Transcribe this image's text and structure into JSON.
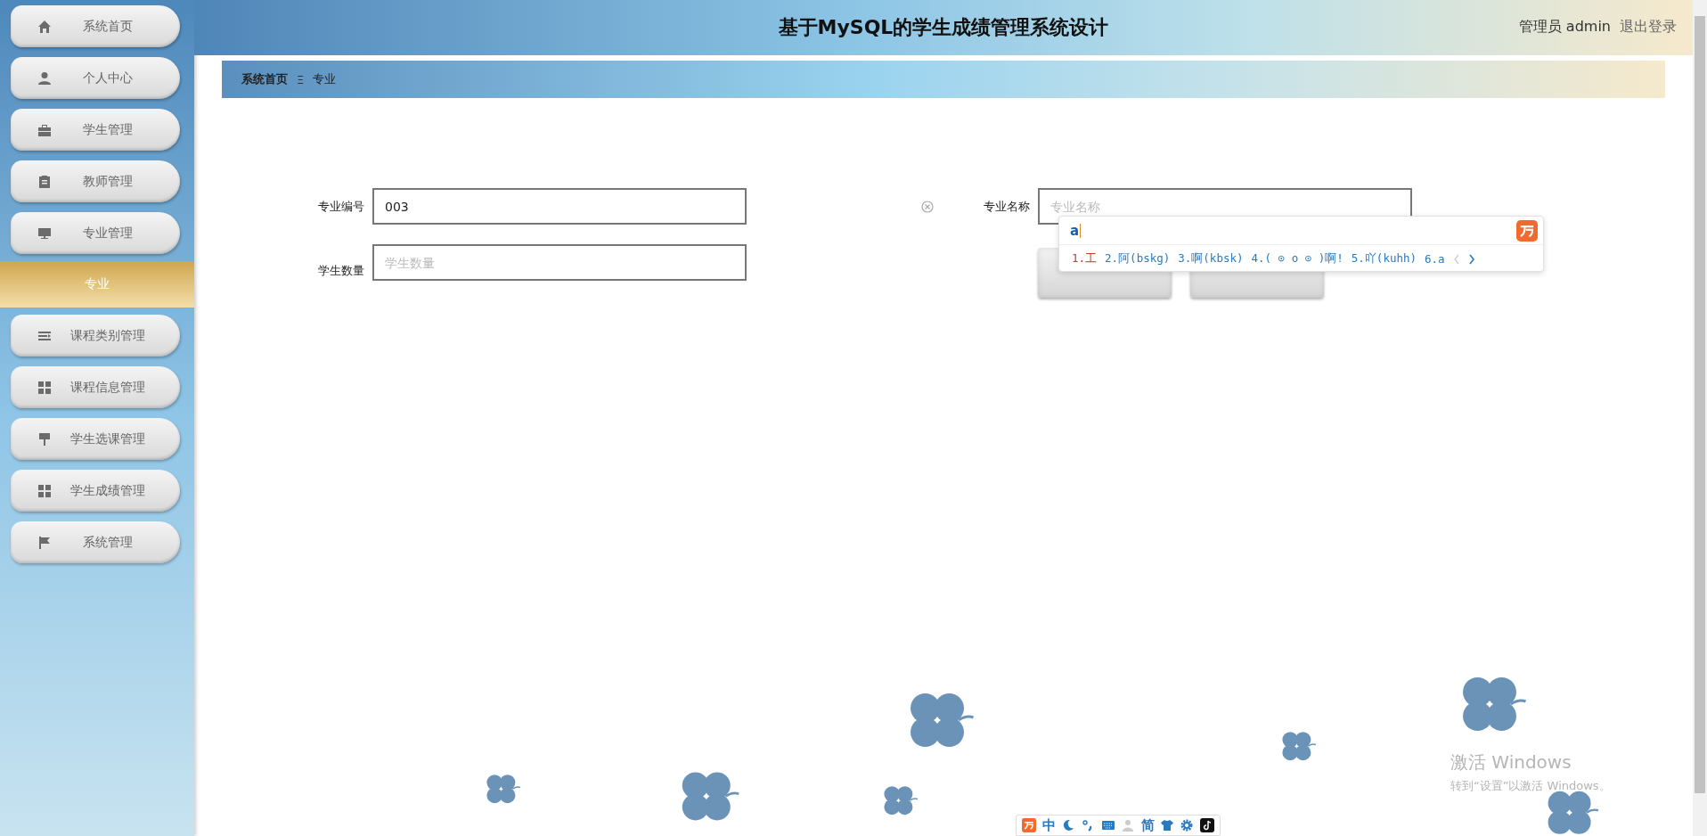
{
  "header": {
    "title": "基于MySQL的学生成绩管理系统设计",
    "user": "管理员 admin",
    "logout": "退出登录"
  },
  "sidebar": {
    "items": [
      {
        "label": "系统首页",
        "selected": false
      },
      {
        "label": "个人中心",
        "selected": false
      },
      {
        "label": "学生管理",
        "selected": false
      },
      {
        "label": "教师管理",
        "selected": false
      },
      {
        "label": "专业管理",
        "selected": false
      },
      {
        "label": "专业",
        "selected": true
      },
      {
        "label": "课程类别管理",
        "selected": false
      },
      {
        "label": "课程信息管理",
        "selected": false
      },
      {
        "label": "学生选课管理",
        "selected": false
      },
      {
        "label": "学生成绩管理",
        "selected": false
      },
      {
        "label": "系统管理",
        "selected": false
      }
    ]
  },
  "breadcrumb": {
    "items": [
      "系统首页",
      "专业"
    ],
    "separator": "Ξ"
  },
  "form": {
    "fields": [
      {
        "label": "专业编号",
        "value": "003"
      },
      {
        "label": "专业名称",
        "placeholder": "专业名称"
      },
      {
        "label": "学生数量",
        "placeholder": "学生数量"
      }
    ]
  },
  "ime": {
    "input": "a",
    "candidates": [
      {
        "text": "1.工",
        "selected": true
      },
      {
        "text": "2.阿(bskg)",
        "selected": false
      },
      {
        "text": "3.啊(kbsk)",
        "selected": false
      },
      {
        "text": "4.( ⊙ o ⊙ )啊!",
        "selected": false
      },
      {
        "text": "5.吖(kuhh)",
        "selected": false
      },
      {
        "text": "6.a",
        "selected": false
      }
    ]
  },
  "ime_toolbar": {
    "mode": "中",
    "script": "简"
  },
  "activation_notice": {
    "title": "激活 Windows",
    "subtitle": "转到“设置”以激活 Windows。"
  }
}
